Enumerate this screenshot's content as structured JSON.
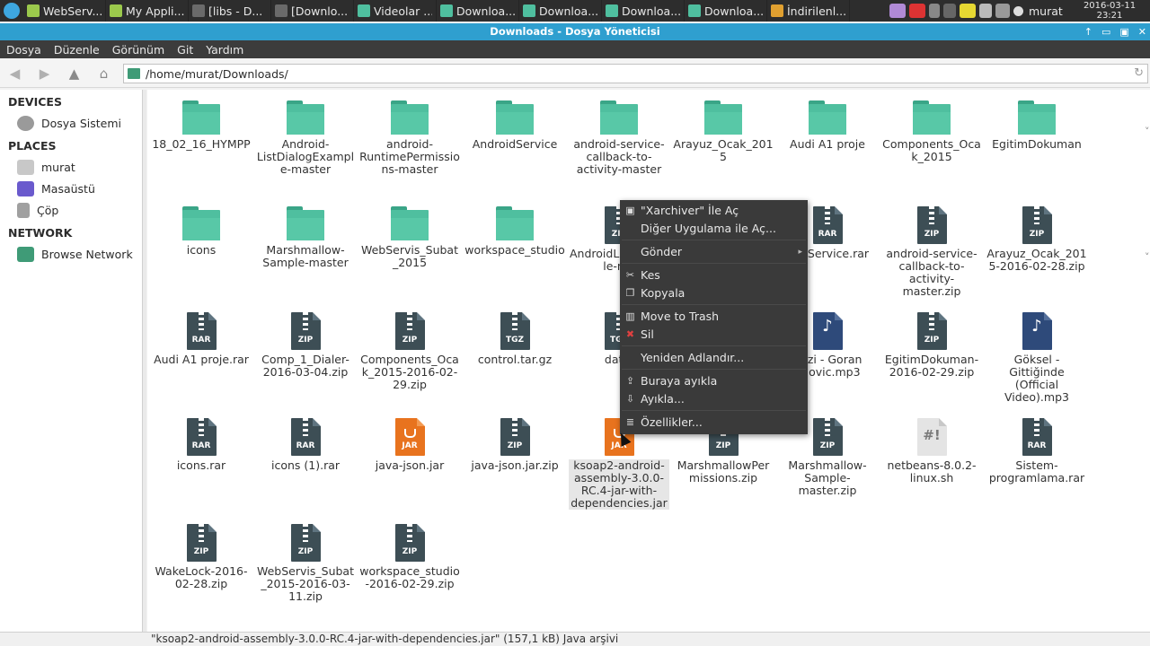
{
  "panel": {
    "tasks": [
      {
        "label": "WebServ...",
        "icon": "android-icon",
        "color": "#9bc94c"
      },
      {
        "label": "My Appli...",
        "icon": "android-icon",
        "color": "#9bc94c"
      },
      {
        "label": "[libs - D...",
        "icon": "window-icon",
        "color": "#6a6a6a"
      },
      {
        "label": "[Downlo...",
        "icon": "window-icon",
        "color": "#6a6a6a"
      },
      {
        "label": "Videolar ...",
        "icon": "folder-icon",
        "color": "#4fbf9f"
      },
      {
        "label": "Downloa...",
        "icon": "folder-icon",
        "color": "#4fbf9f"
      },
      {
        "label": "Downloa...",
        "icon": "folder-icon",
        "color": "#4fbf9f"
      },
      {
        "label": "Downloa...",
        "icon": "folder-icon",
        "color": "#4fbf9f"
      },
      {
        "label": "Downloa...",
        "icon": "folder-icon",
        "color": "#4fbf9f"
      },
      {
        "label": "İndirilenl...",
        "icon": "chrome-icon",
        "color": "#e0a030"
      }
    ],
    "user": "murat",
    "date": "2016-03-11",
    "time": "23:21"
  },
  "window": {
    "title": "Downloads - Dosya Yöneticisi",
    "controls": [
      "↑",
      "▭",
      "▣",
      "✕"
    ]
  },
  "menubar": [
    "Dosya",
    "Düzenle",
    "Görünüm",
    "Git",
    "Yardım"
  ],
  "toolbar": {
    "path": "/home/murat/Downloads/"
  },
  "sidebar": {
    "devices_title": "DEVICES",
    "devices": [
      "Dosya Sistemi"
    ],
    "places_title": "PLACES",
    "places": [
      "murat",
      "Masaüstü",
      "Çöp"
    ],
    "network_title": "NETWORK",
    "network": [
      "Browse Network"
    ]
  },
  "files": [
    {
      "name": "18_02_16_HYMPP",
      "type": "folder"
    },
    {
      "name": "Android-ListDialogExample-master",
      "type": "folder"
    },
    {
      "name": "android-RuntimePermissions-master",
      "type": "folder"
    },
    {
      "name": "AndroidService",
      "type": "folder"
    },
    {
      "name": "android-service-callback-to-activity-master",
      "type": "folder"
    },
    {
      "name": "Arayuz_Ocak_2015",
      "type": "folder"
    },
    {
      "name": "Audi A1 proje",
      "type": "folder"
    },
    {
      "name": "Components_Ocak_2015",
      "type": "folder"
    },
    {
      "name": "EgitimDokuman",
      "type": "folder"
    },
    {
      "name": "icons",
      "type": "folder"
    },
    {
      "name": "Marshmallow-Sample-master",
      "type": "folder"
    },
    {
      "name": "WebServis_Subat_2015",
      "type": "folder"
    },
    {
      "name": "workspace_studio",
      "type": "folder"
    },
    {
      "name": "AndroidListDialogle-ma",
      "type": "archive",
      "tag": "ZIP"
    },
    {
      "name": "",
      "type": "archive",
      "tag": "ZIP"
    },
    {
      "name": "roidService.rar",
      "type": "archive",
      "tag": "RAR"
    },
    {
      "name": "android-service-callback-to-activity-master.zip",
      "type": "archive",
      "tag": "ZIP"
    },
    {
      "name": "Arayuz_Ocak_2015-2016-02-28.zip",
      "type": "archive",
      "tag": "ZIP"
    },
    {
      "name": "Audi A1 proje.rar",
      "type": "archive",
      "tag": "RAR"
    },
    {
      "name": "Comp_1_Dialer-2016-03-04.zip",
      "type": "archive",
      "tag": "ZIP"
    },
    {
      "name": "Components_Ocak_2015-2016-02-29.zip",
      "type": "archive",
      "tag": "ZIP"
    },
    {
      "name": "control.tar.gz",
      "type": "archive",
      "tag": "TGZ"
    },
    {
      "name": "data.",
      "type": "archive",
      "tag": "TGZ"
    },
    {
      "name": "",
      "type": "archive",
      "tag": "ZIP"
    },
    {
      "name": "rlezi - Goran egovic.mp3",
      "type": "music"
    },
    {
      "name": "EgitimDokuman-2016-02-29.zip",
      "type": "archive",
      "tag": "ZIP"
    },
    {
      "name": "Göksel - Gittiğinde (Official Video).mp3",
      "type": "music"
    },
    {
      "name": "icons.rar",
      "type": "archive",
      "tag": "RAR"
    },
    {
      "name": "icons (1).rar",
      "type": "archive",
      "tag": "RAR"
    },
    {
      "name": "java-json.jar",
      "type": "jar",
      "tag": "JAR"
    },
    {
      "name": "java-json.jar.zip",
      "type": "archive",
      "tag": "ZIP"
    },
    {
      "name": "ksoap2-android-assembly-3.0.0-RC.4-jar-with-dependencies.jar",
      "type": "jar",
      "tag": "JAR",
      "selected": true
    },
    {
      "name": "MarshmallowPermissions.zip",
      "type": "archive",
      "tag": "ZIP"
    },
    {
      "name": "Marshmallow-Sample-master.zip",
      "type": "archive",
      "tag": "ZIP"
    },
    {
      "name": "netbeans-8.0.2-linux.sh",
      "type": "script",
      "tag": "#!"
    },
    {
      "name": "Sistem-programlama.rar",
      "type": "archive",
      "tag": "RAR"
    },
    {
      "name": "WakeLock-2016-02-28.zip",
      "type": "archive",
      "tag": "ZIP"
    },
    {
      "name": "WebServis_Subat_2015-2016-03-11.zip",
      "type": "archive",
      "tag": "ZIP"
    },
    {
      "name": "workspace_studio-2016-02-29.zip",
      "type": "archive",
      "tag": "ZIP"
    }
  ],
  "context_menu": [
    {
      "label": "\"Xarchiver\" İle Aç",
      "icon": "archive-icon"
    },
    {
      "label": "Diğer Uygulama ile Aç...",
      "icon": ""
    },
    {
      "label": "Gönder",
      "icon": "",
      "submenu": true
    },
    {
      "label": "Kes",
      "icon": "scissors-icon"
    },
    {
      "label": "Kopyala",
      "icon": "copy-icon"
    },
    {
      "label": "Move to Trash",
      "icon": "trash-icon"
    },
    {
      "label": "Sil",
      "icon": "delete-icon"
    },
    {
      "label": "Yeniden Adlandır...",
      "icon": ""
    },
    {
      "label": "Buraya ayıkla",
      "icon": "extract-icon"
    },
    {
      "label": "Ayıkla...",
      "icon": "extract-to-icon"
    },
    {
      "label": "Özellikler...",
      "icon": "properties-icon"
    }
  ],
  "status": "\"ksoap2-android-assembly-3.0.0-RC.4-jar-with-dependencies.jar\" (157,1 kB) Java arşivi"
}
